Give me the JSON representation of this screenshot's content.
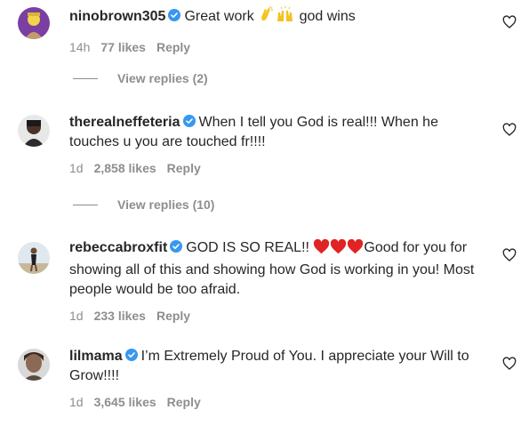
{
  "comments": [
    {
      "username": "ninobrown305",
      "text_before": "Great work",
      "text_after": "god wins",
      "emojis": [
        "clapping-hands",
        "raising-hands"
      ],
      "time": "14h",
      "likes": "77 likes",
      "reply": "Reply"
    },
    {
      "username": "therealneffeteria",
      "text": "When I tell you God is real!!! When he touches u you are touched fr!!!!",
      "time": "1d",
      "likes": "2,858 likes",
      "reply": "Reply"
    },
    {
      "username": "rebeccabroxfit",
      "text_before": "GOD IS SO REAL!!",
      "text_after": "Good for you for showing all of this and showing how God is working in you! Most people would be too afraid.",
      "emojis": [
        "red-heart",
        "red-heart",
        "red-heart"
      ],
      "time": "1d",
      "likes": "233 likes",
      "reply": "Reply"
    },
    {
      "username": "lilmama",
      "text": "I’m Extremely Proud of You. I appreciate your Will to Grow!!!!",
      "time": "1d",
      "likes": "3,645 likes",
      "reply": "Reply"
    }
  ],
  "view_replies": [
    {
      "label": "View replies (2)"
    },
    {
      "label": "View replies (10)"
    }
  ],
  "colors": {
    "text": "#262626",
    "secondary": "#8e8e8e",
    "verified": "#3897f0",
    "heart_red": "#ed4956"
  },
  "icons": {
    "verified": "verified-badge-icon",
    "like": "heart-outline-icon"
  }
}
